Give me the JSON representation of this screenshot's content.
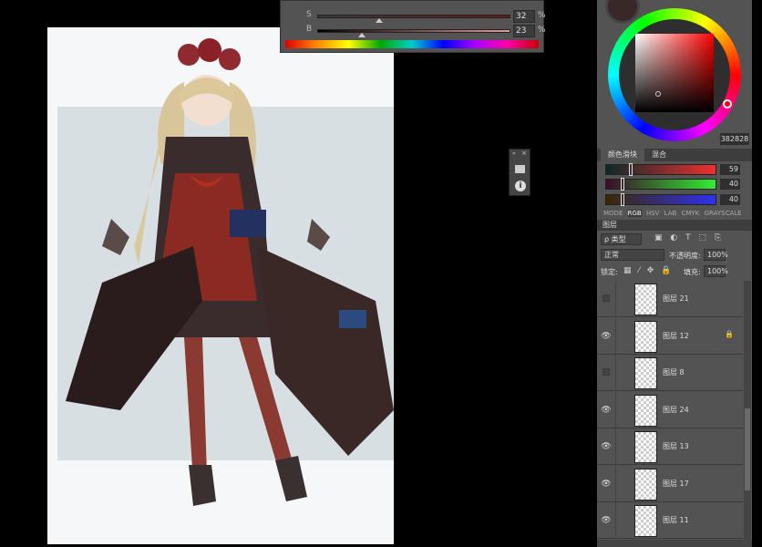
{
  "color_panel": {
    "s_label": "S",
    "s_value": "32",
    "b_label": "B",
    "b_value": "23",
    "unit": "%",
    "s_fraction": 0.32,
    "b_fraction": 0.23
  },
  "color_wheel": {
    "hex": "382828",
    "current_color": "#382828"
  },
  "color_slider": {
    "tabs": [
      "颜色滑块",
      "混合"
    ],
    "r": "59",
    "g": "40",
    "b": "40",
    "r_label": "R",
    "g_label": "G",
    "b_label": "B",
    "modes": [
      "MODE",
      "RGB",
      "HSV",
      "LAB",
      "CMYK",
      "GRAYSCALE"
    ],
    "active_mode": "RGB"
  },
  "layers": {
    "title": "图层",
    "filter": "ρ 类型",
    "blend": "正常",
    "opacity_label": "不透明度:",
    "opacity": "100%",
    "lock_label": "锁定:",
    "fill_label": "填充:",
    "fill": "100%",
    "items": [
      {
        "name": "图层 21",
        "visible": false,
        "locked": false
      },
      {
        "name": "图层 12",
        "visible": true,
        "locked": true
      },
      {
        "name": "图层 8",
        "visible": false,
        "locked": false
      },
      {
        "name": "图层 24",
        "visible": true,
        "locked": false
      },
      {
        "name": "图层 13",
        "visible": true,
        "locked": false
      },
      {
        "name": "图层 17",
        "visible": true,
        "locked": false
      },
      {
        "name": "图层 11",
        "visible": true,
        "locked": false
      }
    ]
  }
}
